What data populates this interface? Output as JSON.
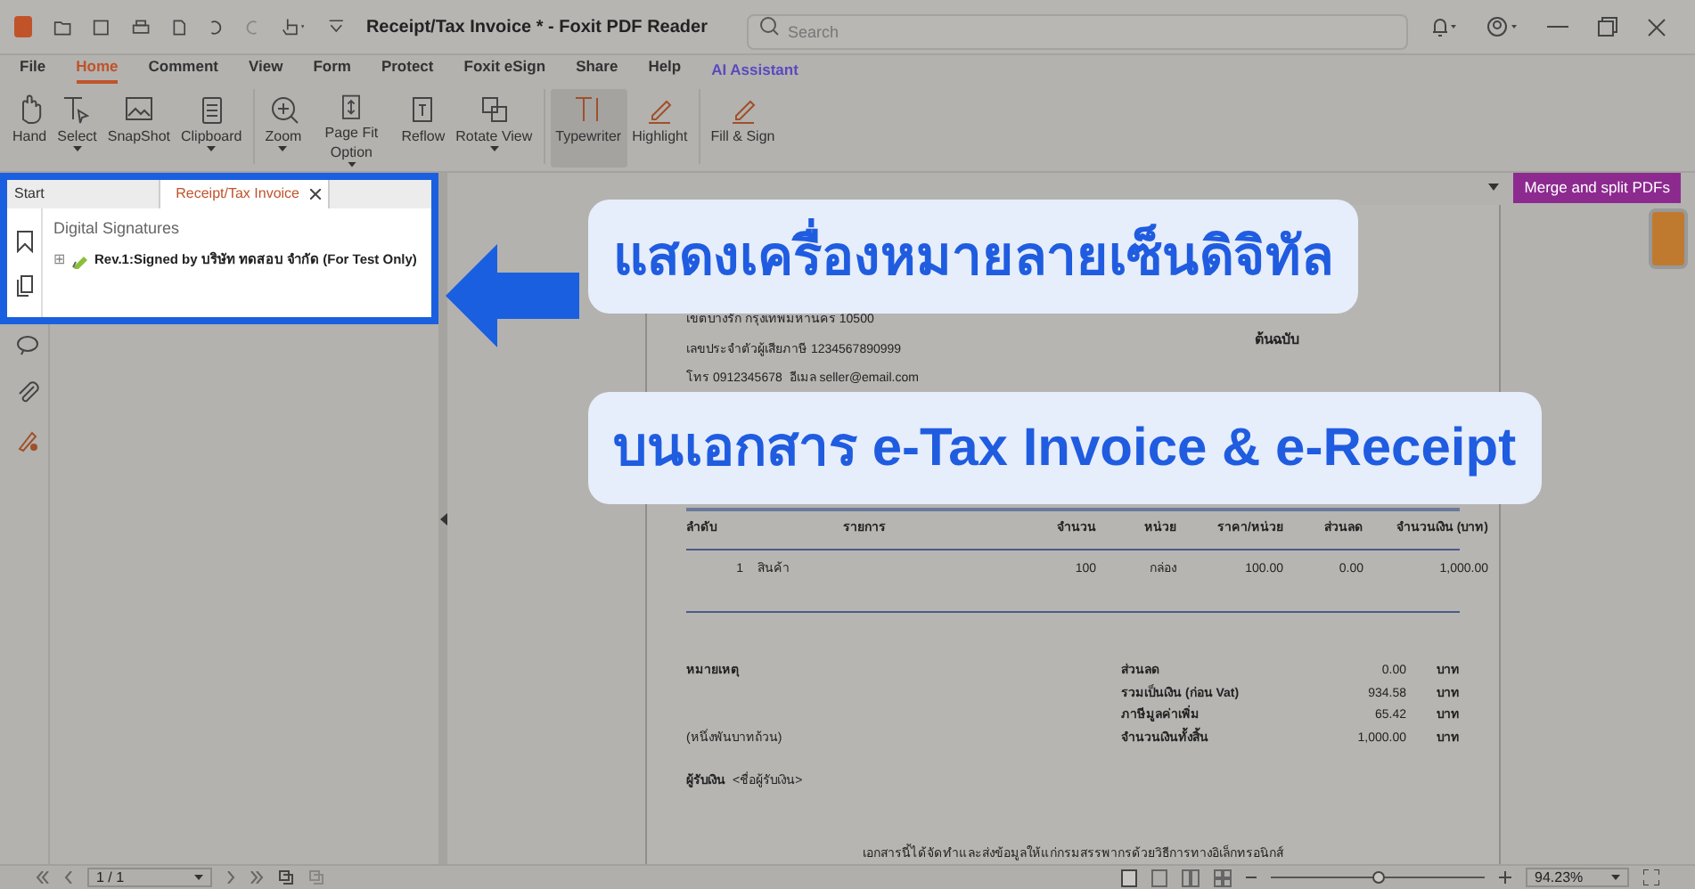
{
  "window": {
    "title": "Receipt/Tax Invoice * - Foxit PDF Reader",
    "search": {
      "placeholder": "Search"
    }
  },
  "menu": [
    {
      "label": "File",
      "selected": false
    },
    {
      "label": "Home",
      "selected": true
    },
    {
      "label": "Comment",
      "selected": false
    },
    {
      "label": "View",
      "selected": false
    },
    {
      "label": "Form",
      "selected": false
    },
    {
      "label": "Protect",
      "selected": false
    },
    {
      "label": "Foxit eSign",
      "selected": false
    },
    {
      "label": "Share",
      "selected": false
    },
    {
      "label": "Help",
      "selected": false
    },
    {
      "label": "AI Assistant",
      "selected": false,
      "kind": "ai"
    }
  ],
  "ribbon": [
    {
      "label": "Hand",
      "dropdown": false,
      "selected": false
    },
    {
      "label": "Select",
      "dropdown": true,
      "selected": false
    },
    {
      "label": "SnapShot",
      "dropdown": false,
      "selected": false
    },
    {
      "label": "Clipboard",
      "dropdown": true,
      "selected": false
    },
    {
      "label": "Zoom",
      "dropdown": true,
      "selected": false,
      "group_start": true
    },
    {
      "label": "Page Fit Option",
      "dropdown": true,
      "selected": false
    },
    {
      "label": "Reflow",
      "dropdown": false,
      "selected": false
    },
    {
      "label": "Rotate View",
      "dropdown": true,
      "selected": false
    },
    {
      "label": "Typewriter",
      "dropdown": false,
      "selected": true,
      "group_start": true
    },
    {
      "label": "Highlight",
      "dropdown": false,
      "selected": false
    },
    {
      "label": "Fill & Sign",
      "dropdown": false,
      "selected": false,
      "group_start": true
    }
  ],
  "doc_tabs": [
    {
      "label": "Start",
      "selected": false
    },
    {
      "label": "Receipt/Tax Invoice",
      "selected": true
    }
  ],
  "merge_button": "Merge and split PDFs",
  "panel": {
    "heading": "Digital Signatures",
    "items": [
      {
        "expander": "⊞",
        "label": "Rev.1:Signed by บริษัท ทดสอบ จำกัด (For Test Only)"
      }
    ]
  },
  "callouts": [
    "แสดงเครื่องหมายลายเซ็นดิจิทัล",
    "บนเอกสาร e-Tax Invoice & e-Receipt"
  ],
  "document": {
    "seller_lines": [
      "เขตบางรัก กรุงเทพมหานคร 10500",
      "เลขประจำตัวผู้เสียภาษี 1234567890999",
      "โทร 0912345678  อีเมล seller@email.com"
    ],
    "copy_label": "ต้นฉบับ",
    "columns": [
      "ลำดับ",
      "รายการ",
      "จำนวน",
      "หน่วย",
      "ราคา/หน่วย",
      "ส่วนลด",
      "จำนวนเงิน (บาท)"
    ],
    "rows": [
      [
        "1",
        "สินค้า",
        "100",
        "กล่อง",
        "100.00",
        "0.00",
        "1,000.00"
      ]
    ],
    "note_label": "หมายเหตุ",
    "amount_words": "(หนึ่งพันบาทถ้วน)",
    "totals": [
      {
        "label": "ส่วนลด",
        "value": "0.00",
        "unit": "บาท"
      },
      {
        "label": "รวมเป็นเงิน (ก่อน Vat)",
        "value": "934.58",
        "unit": "บาท"
      },
      {
        "label": "ภาษีมูลค่าเพิ่ม",
        "value": "65.42",
        "unit": "บาท"
      },
      {
        "label": "จำนวนเงินทั้งสิ้น",
        "value": "1,000.00",
        "unit": "บาท"
      }
    ],
    "receiver_label": "ผู้รับเงิน",
    "receiver_value": "<ชื่อผู้รับเงิน>",
    "footer": "เอกสารนี้ได้จัดทำและส่งข้อมูลให้แก่กรมสรรพากรด้วยวิธีการทางอิเล็กทรอนิกส์"
  },
  "status_bar": {
    "page": "1 / 1",
    "zoom": "94.23%",
    "zoom_slider": {
      "level": 0.5
    }
  }
}
